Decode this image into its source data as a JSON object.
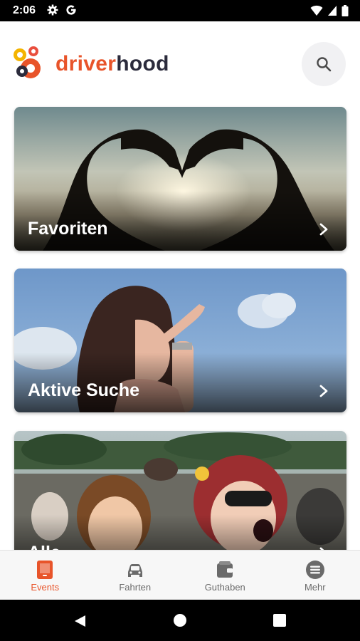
{
  "status_bar": {
    "time": "2:06",
    "icons_left": [
      "settings-gear",
      "google-g"
    ],
    "icons_right": [
      "wifi",
      "cellular-signal",
      "battery"
    ]
  },
  "header": {
    "brand_primary": "driver",
    "brand_secondary": "hood",
    "search_icon": "search-icon"
  },
  "cards": [
    {
      "title": "Favoriten"
    },
    {
      "title": "Aktive Suche"
    },
    {
      "title": "Alle"
    }
  ],
  "bottom_nav": {
    "items": [
      {
        "label": "Events",
        "icon": "tablet-icon",
        "active": true
      },
      {
        "label": "Fahrten",
        "icon": "car-icon",
        "active": false
      },
      {
        "label": "Guthaben",
        "icon": "wallet-icon",
        "active": false
      },
      {
        "label": "Mehr",
        "icon": "menu-icon",
        "active": false
      }
    ]
  },
  "colors": {
    "accent": "#e8542a",
    "brand_dark": "#2b2b3c",
    "nav_inactive": "#6a6a6a"
  }
}
